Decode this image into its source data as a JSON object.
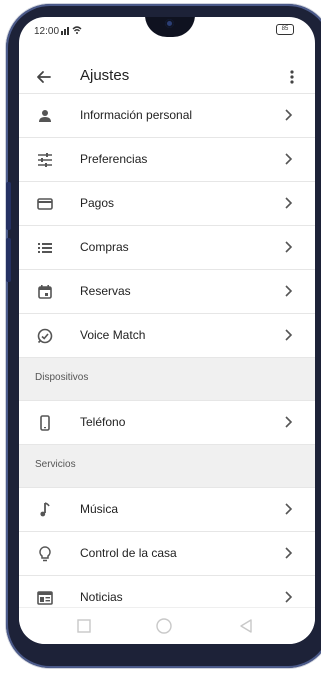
{
  "status": {
    "time": "12:00",
    "signal": "ᵤıll ⤳",
    "battery": "85"
  },
  "app_bar": {
    "title": "Ajustes"
  },
  "items": [
    {
      "label": "Información personal",
      "icon": "person-icon"
    },
    {
      "label": "Preferencias",
      "icon": "tune-icon"
    },
    {
      "label": "Pagos",
      "icon": "credit-card-icon"
    },
    {
      "label": "Compras",
      "icon": "list-icon"
    },
    {
      "label": "Reservas",
      "icon": "calendar-icon"
    },
    {
      "label": "Voice Match",
      "icon": "voice-match-icon"
    }
  ],
  "sections": {
    "dispositivos": {
      "title": "Dispositivos",
      "items": [
        {
          "label": "Teléfono",
          "icon": "phone-icon"
        }
      ]
    },
    "servicios": {
      "title": "Servicios",
      "items": [
        {
          "label": "Música",
          "icon": "music-note-icon"
        },
        {
          "label": "Control de la casa",
          "icon": "lightbulb-icon"
        },
        {
          "label": "Noticias",
          "icon": "news-icon"
        }
      ]
    }
  }
}
